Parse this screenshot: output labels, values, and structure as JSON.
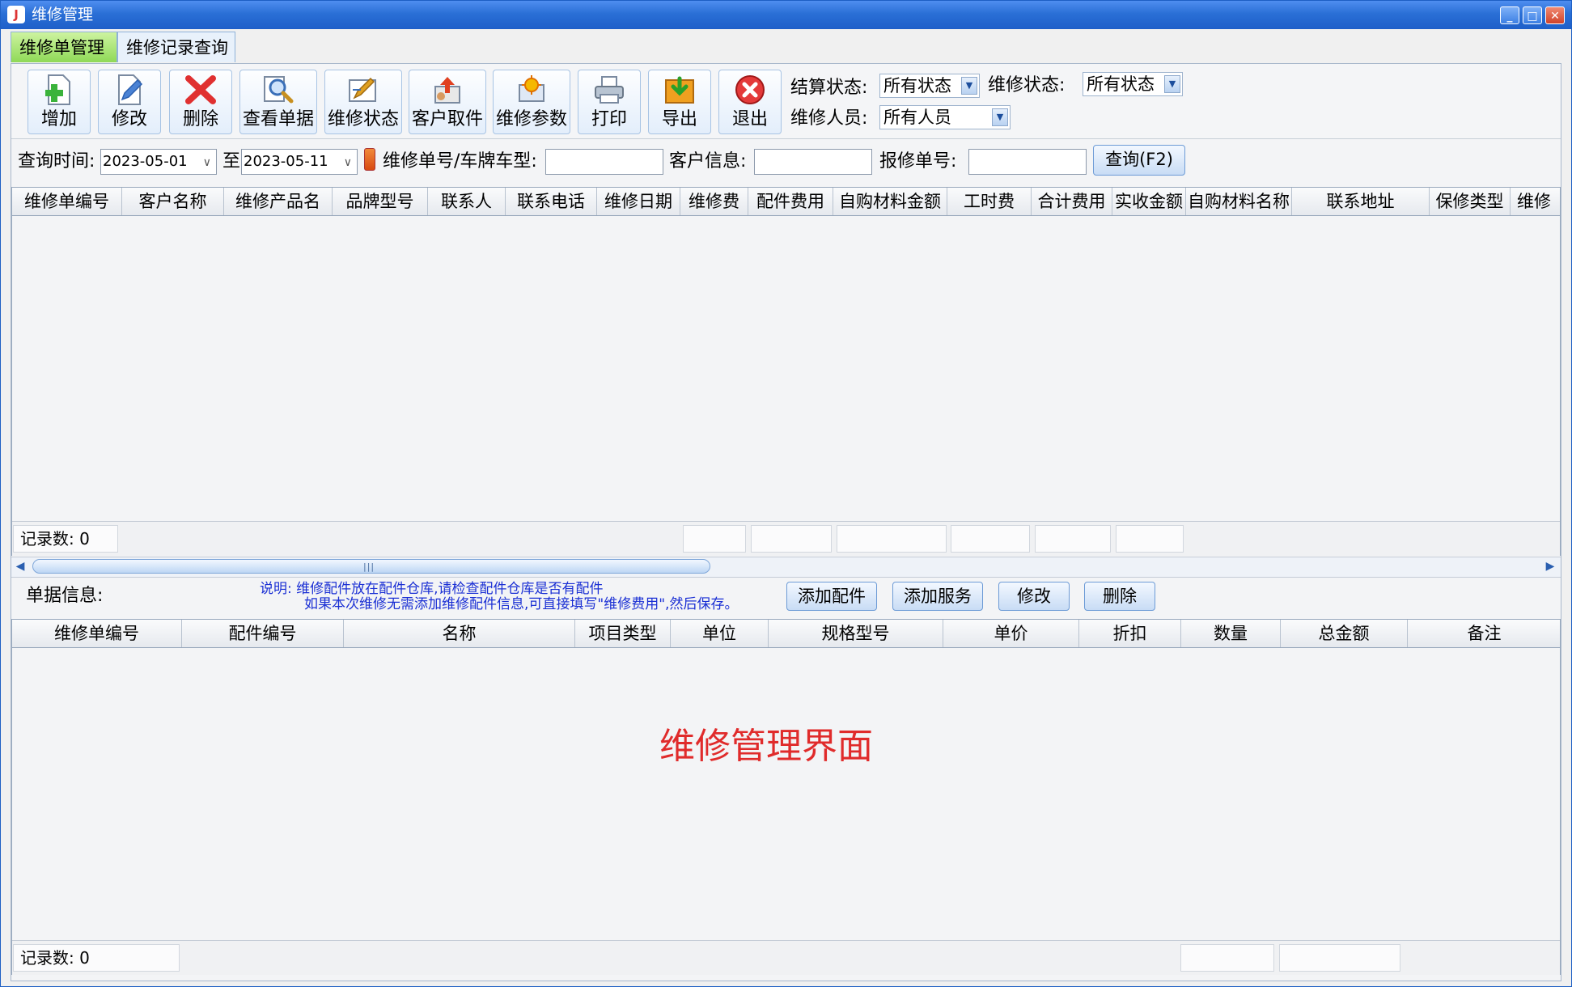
{
  "window": {
    "title": "维修管理"
  },
  "tabs": [
    {
      "label": "维修单管理",
      "active": true
    },
    {
      "label": "维修记录查询",
      "active": false
    }
  ],
  "toolbar": {
    "buttons": [
      {
        "label": "增加",
        "icon": "add-document-icon"
      },
      {
        "label": "修改",
        "icon": "edit-icon"
      },
      {
        "label": "删除",
        "icon": "delete-x-icon"
      },
      {
        "label": "查看单据",
        "icon": "magnifier-document-icon"
      },
      {
        "label": "维修状态",
        "icon": "status-pencil-icon"
      },
      {
        "label": "客户取件",
        "icon": "customer-pickup-icon"
      },
      {
        "label": "维修参数",
        "icon": "settings-icon"
      },
      {
        "label": "打印",
        "icon": "printer-icon"
      },
      {
        "label": "导出",
        "icon": "export-icon"
      },
      {
        "label": "退出",
        "icon": "exit-icon"
      }
    ]
  },
  "filters": {
    "settle_status": {
      "label": "结算状态:",
      "value": "所有状态"
    },
    "repair_status": {
      "label": "维修状态:",
      "value": "所有状态"
    },
    "repair_staff": {
      "label": "维修人员:",
      "value": "所有人员"
    }
  },
  "query": {
    "time_label": "查询时间:",
    "date_from": "2023-05-01",
    "to_label": "至",
    "date_to": "2023-05-11",
    "order_plate_label": "维修单号/车牌车型:",
    "customer_label": "客户信息:",
    "report_no_label": "报修单号:",
    "query_button": "查询(F2)"
  },
  "main_grid": {
    "columns": [
      "维修单编号",
      "客户名称",
      "维修产品名",
      "品牌型号",
      "联系人",
      "联系电话",
      "维修日期",
      "维修费",
      "配件费用",
      "自购材料金额",
      "工时费",
      "合计费用",
      "实收金额",
      "自购材料名称",
      "联系地址",
      "保修类型",
      "维修"
    ],
    "record_count": "记录数: 0"
  },
  "detail": {
    "info_label": "单据信息:",
    "note_line1": "说明: 维修配件放在配件仓库,请检查配件仓库是否有配件",
    "note_line2": "如果本次维修无需添加维修配件信息,可直接填写\"维修费用\",然后保存。",
    "buttons": [
      "添加配件",
      "添加服务",
      "修改",
      "删除"
    ]
  },
  "detail_grid": {
    "columns": [
      "维修单编号",
      "配件编号",
      "名称",
      "项目类型",
      "单位",
      "规格型号",
      "单价",
      "折扣",
      "数量",
      "总金额",
      "备注"
    ],
    "record_count": "记录数: 0"
  },
  "watermark": "维修管理界面",
  "colors": {
    "title_bar": "#2a6fd6",
    "active_tab": "#8fd957",
    "watermark": "#e02b2b",
    "note_text": "#1a2fd4"
  }
}
